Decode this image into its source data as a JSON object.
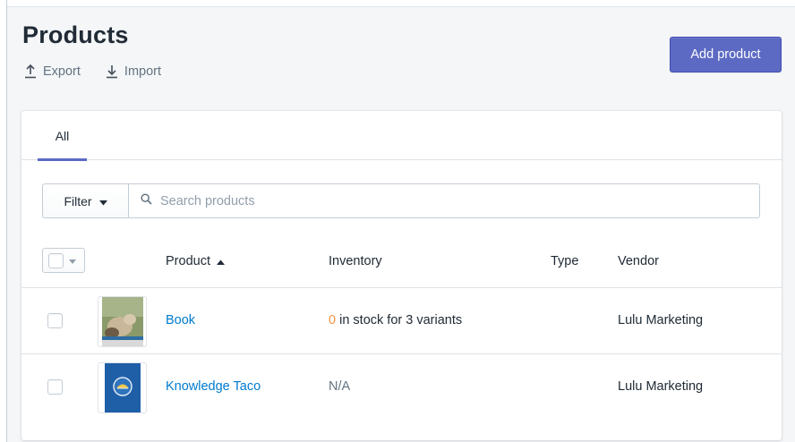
{
  "page": {
    "title": "Products",
    "actions": [
      {
        "label": "Export",
        "icon": "export-icon"
      },
      {
        "label": "Import",
        "icon": "import-icon"
      }
    ],
    "primary_action": "Add product"
  },
  "tabs": [
    {
      "label": "All",
      "active": true
    }
  ],
  "filter": {
    "label": "Filter",
    "search_placeholder": "Search products"
  },
  "table": {
    "columns": {
      "product": "Product",
      "inventory": "Inventory",
      "type": "Type",
      "vendor": "Vendor"
    },
    "sort": {
      "column": "Product",
      "direction": "ascending"
    },
    "rows": [
      {
        "name": "Book",
        "thumbnail": "book-cover-image",
        "inventory_count": "0",
        "inventory_text": " in stock for 3 variants",
        "type": "",
        "vendor": "Lulu Marketing"
      },
      {
        "name": "Knowledge Taco",
        "thumbnail": "knowledge-taco-image",
        "inventory_text": "N/A",
        "type": "",
        "vendor": "Lulu Marketing"
      }
    ]
  },
  "colors": {
    "accent": "#5c6ac4",
    "link": "#007ace",
    "warning": "#f49342",
    "muted": "#637381"
  }
}
